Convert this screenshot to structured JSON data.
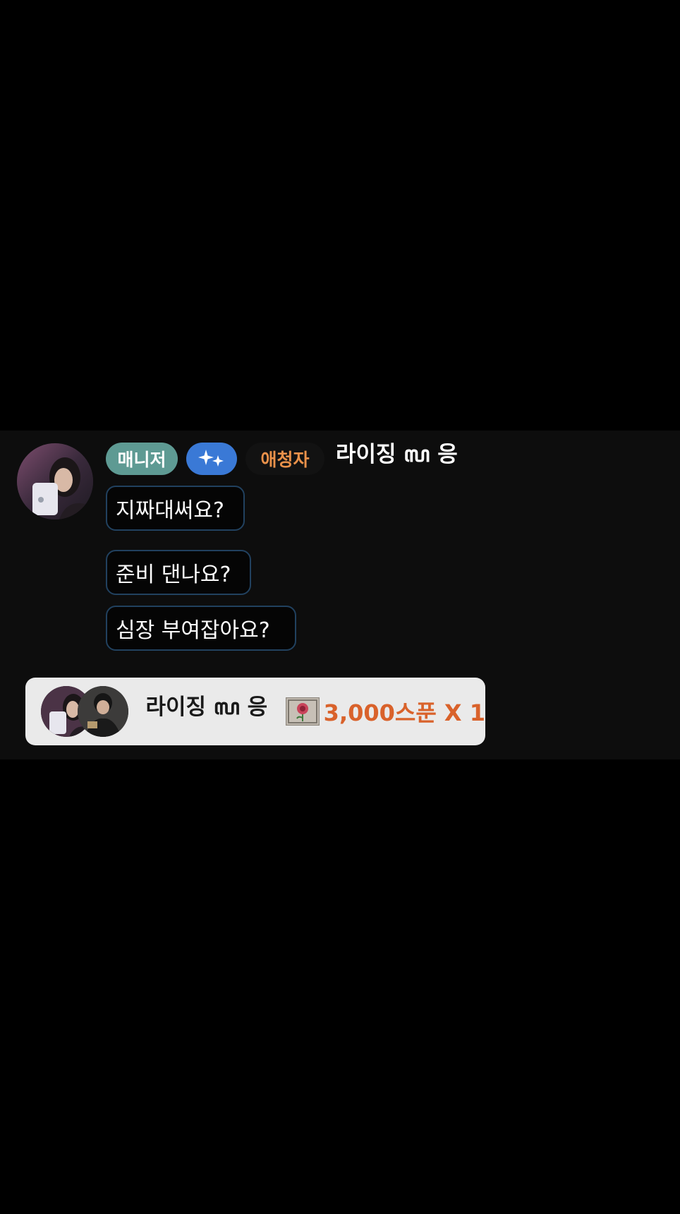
{
  "message": {
    "badges": {
      "manager": "매니저",
      "sparkle_icon": "sparkle-icon",
      "fan": "애청자"
    },
    "username": "라이징 ꧗ 응",
    "lines": [
      "지짜대써요?",
      "준비 댄나요?",
      "심장 부여잡아요?"
    ]
  },
  "gift": {
    "sender": "라이징 ꧗ 응",
    "item_icon": "rose-gift-icon",
    "amount": "3,000스푼 X 1"
  },
  "colors": {
    "background": "#000000",
    "panel": "#0d0d0d",
    "manager_badge": "#5e9a93",
    "sparkle_badge": "#3a79d6",
    "fan_badge_text": "#e9914a",
    "bubble_border": "#21415f",
    "gift_card": "#eaeaea",
    "gift_amount": "#d9622b"
  }
}
